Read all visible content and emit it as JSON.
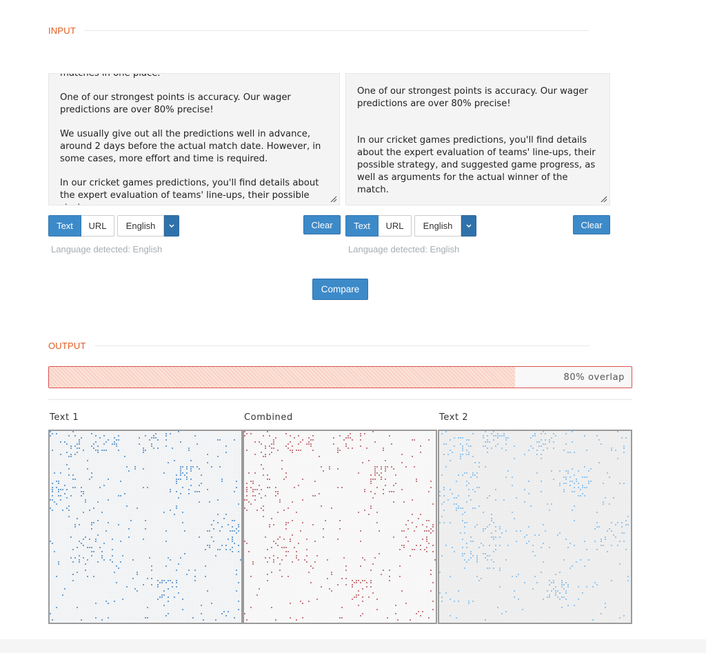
{
  "input": {
    "heading": "INPUT",
    "text1": {
      "paragraphs": [
        "matches in one place.",
        "One of our strongest points is accuracy. Our wager predictions are over 80% precise!",
        "We usually give out all the predictions well in advance, around 2 days before the actual match date. However, in some cases, more effort and time is required.",
        "In our cricket games predictions, you'll find details about the expert evaluation of teams' line-ups, their possible strategy"
      ],
      "mode_buttons": [
        "Text",
        "URL"
      ],
      "active_mode": "Text",
      "language": "English",
      "clear_label": "Clear",
      "detected": "Language detected: English"
    },
    "text2": {
      "paragraphs": [
        "One of our strongest points is accuracy. Our wager predictions are over 80% precise!",
        "In our cricket games predictions, you'll find details about the expert evaluation of teams' line-ups, their possible strategy, and suggested game progress, as well as arguments for the actual winner of the match."
      ],
      "mode_buttons": [
        "Text",
        "URL"
      ],
      "active_mode": "Text",
      "language": "English",
      "clear_label": "Clear",
      "detected": "Language detected: English"
    },
    "compare_label": "Compare"
  },
  "output": {
    "heading": "OUTPUT",
    "overlap_percent": 80,
    "overlap_label": "80% overlap",
    "panels": [
      "Text 1",
      "Combined",
      "Text 2"
    ]
  },
  "colors": {
    "accent": "#3d8ac9",
    "heading": "#e05a1e",
    "text1_dots": "#6b9fd0",
    "combined_dots": "#c77a80",
    "text2_dots": "#93c6ee",
    "bar_border": "#d9534f"
  }
}
